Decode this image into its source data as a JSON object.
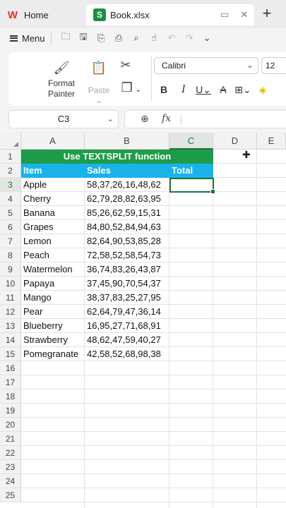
{
  "tabs": {
    "home": "Home",
    "file": "Book.xlsx",
    "file_logo": "S",
    "home_logo": "W"
  },
  "menu": {
    "label": "Menu"
  },
  "ribbon": {
    "format_painter_line1": "Format",
    "format_painter_line2": "Painter",
    "paste": "Paste",
    "font_name": "Calibri",
    "font_size": "12"
  },
  "formula_bar": {
    "name_box": "C3",
    "fx": "fx",
    "value": ""
  },
  "columns": [
    "A",
    "B",
    "C",
    "D",
    "E"
  ],
  "active_column": "C",
  "active_row": 3,
  "rows": [
    1,
    2,
    3,
    4,
    5,
    6,
    7,
    8,
    9,
    10,
    11,
    12,
    13,
    14,
    15,
    16,
    17,
    18,
    19,
    20,
    21,
    22,
    23,
    24,
    25
  ],
  "sheet": {
    "title": "Use TEXTSPLIT function",
    "headers": [
      "Item",
      "Sales",
      "Total"
    ],
    "data": [
      {
        "item": "Apple",
        "sales": "58,37,26,16,48,62"
      },
      {
        "item": "Cherry",
        "sales": "62,79,28,82,63,95"
      },
      {
        "item": "Banana",
        "sales": "85,26,62,59,15,31"
      },
      {
        "item": "Grapes",
        "sales": "84,80,52,84,94,63"
      },
      {
        "item": "Lemon",
        "sales": "82,64,90,53,85,28"
      },
      {
        "item": "Peach",
        "sales": "72,58,52,58,54,73"
      },
      {
        "item": "Watermelon",
        "sales": "36,74,83,26,43,87"
      },
      {
        "item": "Papaya",
        "sales": "37,45,90,70,54,37"
      },
      {
        "item": "Mango",
        "sales": "38,37,83,25,27,95"
      },
      {
        "item": "Pear",
        "sales": "62,64,79,47,36,14"
      },
      {
        "item": "Blueberry",
        "sales": "16,95,27,71,68,91"
      },
      {
        "item": "Strawberry",
        "sales": "48,62,47,59,40,27"
      },
      {
        "item": "Pomegranate",
        "sales": "42,58,52,68,98,38"
      }
    ]
  },
  "colors": {
    "title_bg": "#1e9c49",
    "header_bg": "#19b3ea",
    "selection": "#21703d"
  }
}
